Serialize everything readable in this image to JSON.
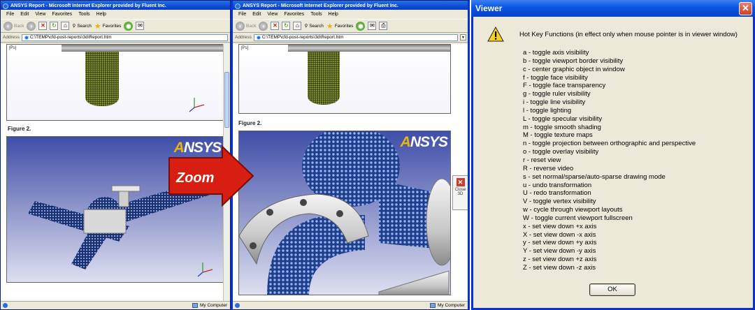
{
  "left_window": {
    "title": "ANSYS Report - Microsoft Internet Explorer provided by Fluent Inc.",
    "menu": [
      "File",
      "Edit",
      "View",
      "Favorites",
      "Tools",
      "Help"
    ],
    "back_label": "Back",
    "search_label": "Search",
    "favorites_label": "Favorites",
    "address_label": "Address",
    "address_value": "C:\\TEMP\\cfd-post-reports\\3d\\Report.htm",
    "ps_code": "[Ps]",
    "figure_label": "Figure 2.",
    "status_text": "My Computer"
  },
  "middle_window": {
    "title": "ANSYS Report - Microsoft Internet Explorer provided by Fluent Inc.",
    "menu": [
      "File",
      "Edit",
      "View",
      "Favorites",
      "Tools",
      "Help"
    ],
    "back_label": "Back",
    "search_label": "Search",
    "favorites_label": "Favorites",
    "address_label": "Address",
    "address_value": "C:\\TEMP\\cfd-post-reports\\3d\\Report.htm",
    "ps_code": "[Ps]",
    "figure_label": "Figure 2.",
    "close3d_label": "Close 3D",
    "status_text": "My Computer"
  },
  "zoom_label": "Zoom",
  "ansys_logo": "ANSYS",
  "viewer": {
    "title": "Viewer",
    "heading": "Hot Key Functions (in effect only when mouse pointer is in viewer window)",
    "hotkeys": [
      "a - toggle axis visibility",
      "b - toggle viewport border visibility",
      "c - center graphic object in window",
      "f - toggle face visibility",
      "F - toggle face transparency",
      "g - toggle ruler visibility",
      "i - toggle line visibility",
      "l - toggle lighting",
      "L - toggle specular visibility",
      "m - toggle smooth shading",
      "M - toggle texture maps",
      "n - toggle projection between orthographic and perspective",
      "o - toggle overlay visibility",
      "r - reset view",
      "R - reverse video",
      "s - set normal/sparse/auto-sparse drawing mode",
      "u - undo transformation",
      "U - redo transformation",
      "V - toggle vertex visibility",
      "w - cycle through viewport layouts",
      "W - toggle current viewport fullscreen",
      "x - set view down +x axis",
      "X - set view down -x axis",
      "y - set view down +y axis",
      "Y - set view down -y axis",
      "z - set view down +z axis",
      "Z - set view down -z axis"
    ],
    "ok_label": "OK"
  },
  "colors": {
    "xp_blue": "#0a4ed6",
    "dialog_bg": "#ece9d8",
    "zoom_red": "#d81e10",
    "mesh_blue": "#1e3a80"
  }
}
